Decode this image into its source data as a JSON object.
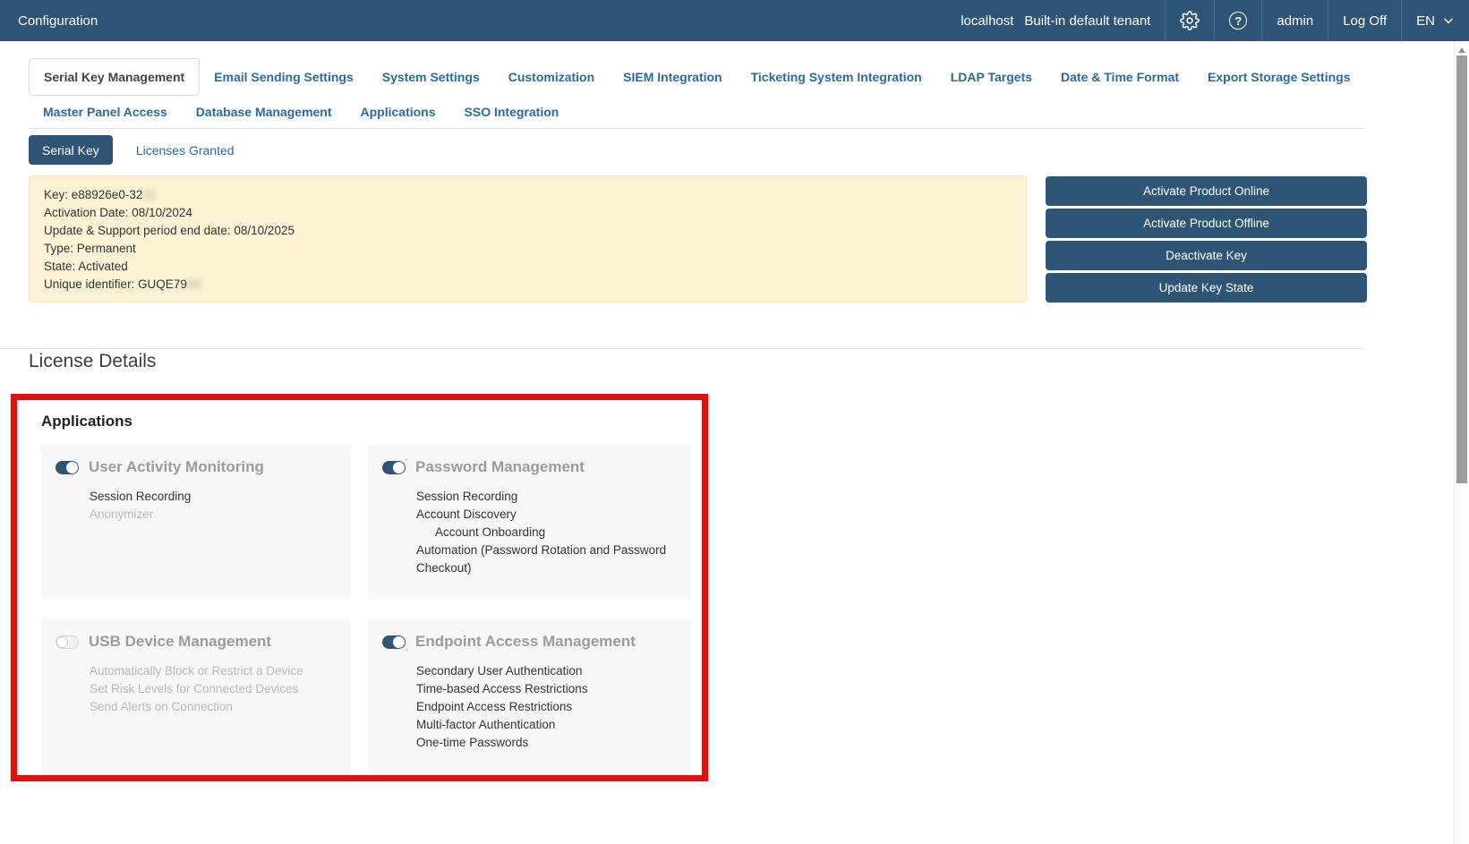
{
  "colors": {
    "accent": "#2e5574",
    "link_blue": "#2c6a9e",
    "highlight_red": "#e01111",
    "warning_bg": "#fbf3d3",
    "warning_border": "#f1e7c4",
    "card_bg": "#f7f7f7",
    "title_gray": "#9b9b9b",
    "disabled_text": "#b8b8b8"
  },
  "topbar": {
    "title": "Configuration",
    "host": "localhost",
    "tenant": "Built-in default tenant",
    "user": "admin",
    "log_off": "Log Off",
    "language": "EN"
  },
  "icons": {
    "settings": "gear-icon",
    "help": "help-icon",
    "help_glyph": "?",
    "language_chevron": "chevron-down-icon",
    "scroll_up": "scroll-up-icon"
  },
  "tabs": {
    "active": "Serial Key Management",
    "row1": [
      "Serial Key Management",
      "Email Sending Settings",
      "System Settings",
      "Customization",
      "SIEM Integration",
      "Ticketing System Integration",
      "LDAP Targets",
      "Date & Time Format",
      "Export Storage Settings"
    ],
    "row2": [
      "Master Panel Access",
      "Database Management",
      "Applications",
      "SSO Integration"
    ]
  },
  "subtabs": {
    "active": "Serial Key",
    "inactive": "Licenses Granted"
  },
  "serial_key_box": {
    "lines": [
      {
        "text": "Key: e88926e0-32",
        "redacted": "21"
      },
      {
        "text": "Activation Date: 08/10/2024",
        "redacted": ""
      },
      {
        "text": "Update & Support period end date: 08/10/2025",
        "redacted": ""
      },
      {
        "text": "Type: Permanent",
        "redacted": ""
      },
      {
        "text": "State: Activated",
        "redacted": ""
      },
      {
        "text": "Unique identifier: GUQE79",
        "redacted": "5X"
      }
    ]
  },
  "actions": [
    "Activate Product Online",
    "Activate Product Offline",
    "Deactivate Key",
    "Update Key State"
  ],
  "license_details": {
    "heading": "License Details"
  },
  "applications": {
    "heading": "Applications",
    "cards": [
      {
        "title": "User Activity Monitoring",
        "enabled": true,
        "items": [
          {
            "label": "Session Recording",
            "active": true,
            "indent": 0
          },
          {
            "label": "Anonymizer",
            "active": false,
            "indent": 0
          }
        ]
      },
      {
        "title": "Password Management",
        "enabled": true,
        "items": [
          {
            "label": "Session Recording",
            "active": true,
            "indent": 0
          },
          {
            "label": "Account Discovery",
            "active": true,
            "indent": 0
          },
          {
            "label": "Account Onboarding",
            "active": true,
            "indent": 1
          },
          {
            "label": "Automation (Password Rotation and Password Checkout)",
            "active": true,
            "indent": 0
          }
        ]
      },
      {
        "title": "USB Device Management",
        "enabled": false,
        "items": [
          {
            "label": "Automatically Block or Restrict a Device",
            "active": false,
            "indent": 0
          },
          {
            "label": "Set Risk Levels for Connected Devices",
            "active": false,
            "indent": 0
          },
          {
            "label": "Send Alerts on Connection",
            "active": false,
            "indent": 0
          }
        ]
      },
      {
        "title": "Endpoint Access Management",
        "enabled": true,
        "items": [
          {
            "label": "Secondary User Authentication",
            "active": true,
            "indent": 0
          },
          {
            "label": "Time-based Access Restrictions",
            "active": true,
            "indent": 0
          },
          {
            "label": "Endpoint Access Restrictions",
            "active": true,
            "indent": 0
          },
          {
            "label": "Multi-factor Authentication",
            "active": true,
            "indent": 0
          },
          {
            "label": "One-time Passwords",
            "active": true,
            "indent": 0
          }
        ]
      }
    ]
  }
}
